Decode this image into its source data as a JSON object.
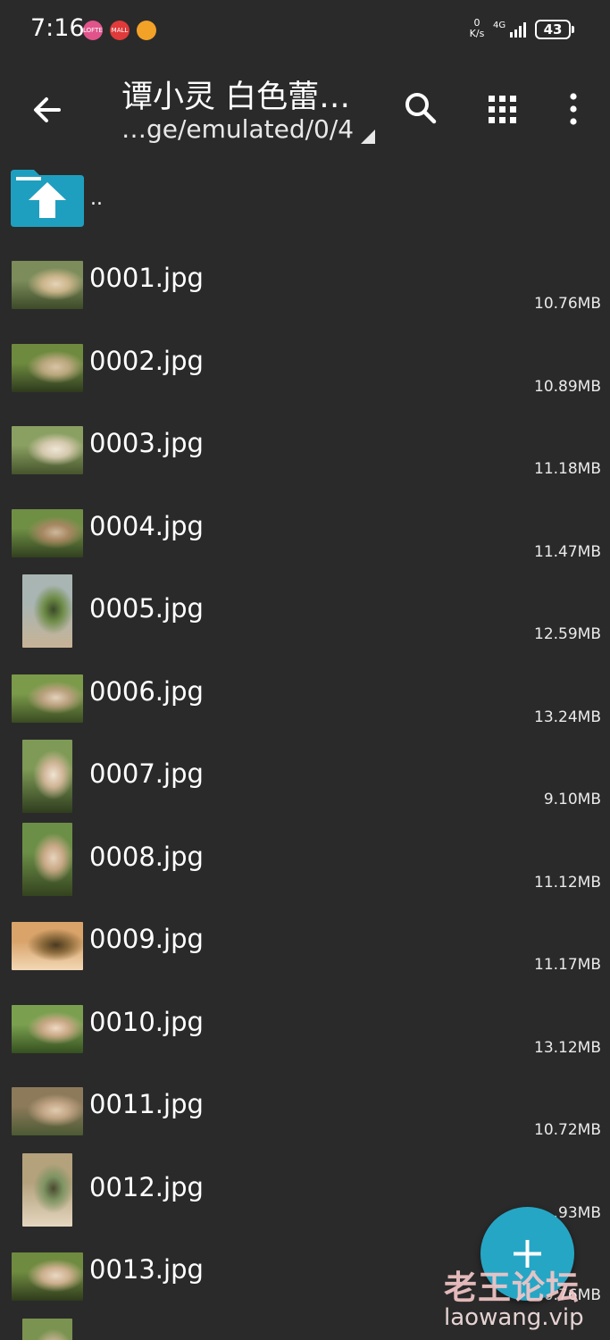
{
  "status_bar": {
    "time": "7:16",
    "app_icons": [
      {
        "name": "lofter-icon",
        "color": "#e0548b",
        "text": "LOFTER"
      },
      {
        "name": "mall-icon",
        "color": "#e03a3a",
        "text": "MALL"
      },
      {
        "name": "weibo-icon",
        "color": "#f2a227",
        "text": ""
      }
    ],
    "net_speed_value": "0",
    "net_speed_unit": "K/s",
    "network_type": "4G",
    "battery_level": "43"
  },
  "toolbar": {
    "title": "谭小灵 白色蕾…",
    "path": "…ge/emulated/0/4"
  },
  "parent_entry": {
    "label": ".."
  },
  "files": [
    {
      "name": "0001.jpg",
      "size": "10.76MB",
      "orientation": "land",
      "palette": [
        "#7c8c5a",
        "#c9b48a",
        "#3c4a28",
        "#e6d2b8"
      ]
    },
    {
      "name": "0002.jpg",
      "size": "10.89MB",
      "orientation": "land",
      "palette": [
        "#6e8a3e",
        "#b9a77e",
        "#2e3a1e",
        "#d8c3a3"
      ]
    },
    {
      "name": "0003.jpg",
      "size": "11.18MB",
      "orientation": "land",
      "palette": [
        "#8aa062",
        "#d5c9ae",
        "#46542c",
        "#eee6d6"
      ]
    },
    {
      "name": "0004.jpg",
      "size": "11.47MB",
      "orientation": "land",
      "palette": [
        "#6f8f44",
        "#a78762",
        "#31401f",
        "#cdb89a"
      ]
    },
    {
      "name": "0005.jpg",
      "size": "12.59MB",
      "orientation": "port",
      "palette": [
        "#a9b5b3",
        "#6f8c48",
        "#c7b396",
        "#3a4a28"
      ]
    },
    {
      "name": "0006.jpg",
      "size": "13.24MB",
      "orientation": "land",
      "palette": [
        "#7b9a4a",
        "#bba17f",
        "#3a4b22",
        "#e3d2bb"
      ]
    },
    {
      "name": "0007.jpg",
      "size": "9.10MB",
      "orientation": "port",
      "palette": [
        "#7e9a56",
        "#d0b597",
        "#2f3d1e",
        "#efe3d2"
      ]
    },
    {
      "name": "0008.jpg",
      "size": "11.12MB",
      "orientation": "port",
      "palette": [
        "#6c8f47",
        "#c9a987",
        "#34431f",
        "#e7d4bd"
      ]
    },
    {
      "name": "0009.jpg",
      "size": "11.17MB",
      "orientation": "land",
      "palette": [
        "#d9a36a",
        "#8c6b3c",
        "#f2d8b5",
        "#4a3a20"
      ]
    },
    {
      "name": "0010.jpg",
      "size": "13.12MB",
      "orientation": "land",
      "palette": [
        "#7aa04f",
        "#c9a886",
        "#355020",
        "#eed9c2"
      ]
    },
    {
      "name": "0011.jpg",
      "size": "10.72MB",
      "orientation": "land",
      "palette": [
        "#8c7a5a",
        "#c2a585",
        "#4c5a34",
        "#e0cbb0"
      ]
    },
    {
      "name": "0012.jpg",
      "size": "…93MB",
      "orientation": "port",
      "palette": [
        "#b4a27d",
        "#7e9462",
        "#e4d6c0",
        "#4a4a30"
      ]
    },
    {
      "name": "0013.jpg",
      "size": "10.76MB",
      "orientation": "land",
      "palette": [
        "#6f8b40",
        "#cdb08e",
        "#2f3b1c",
        "#e9d8c4"
      ]
    },
    {
      "name": "",
      "size": "",
      "orientation": "port",
      "palette": [
        "#7b9350",
        "#c9b496",
        "#34431f",
        "#e2d1bb"
      ]
    }
  ],
  "fab": {
    "icon": "plus-icon",
    "color": "#26a6c5"
  },
  "watermark": {
    "title": "老王论坛",
    "url": "laowang.vip"
  },
  "colors": {
    "background": "#2a2a2a",
    "folder": "#1f9fbf"
  }
}
